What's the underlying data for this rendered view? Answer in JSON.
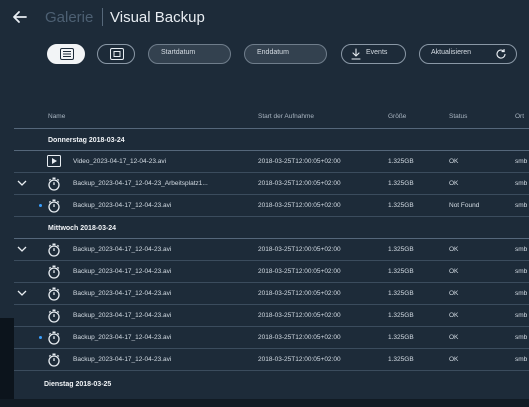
{
  "header": {
    "parent": "Galerie",
    "title": "Visual Backup"
  },
  "toolbar": {
    "start_date": "Startdatum",
    "end_date": "Enddatum",
    "events": "Events",
    "refresh": "Aktualisieren"
  },
  "columns": {
    "name": "Name",
    "start": "Start der Aufnahme",
    "size": "Größe",
    "status": "Status",
    "ort": "Ort"
  },
  "groups": [
    {
      "label": "Donnerstag 2018-03-24"
    },
    {
      "label": "Mittwoch 2018-03-24"
    },
    {
      "label": "Dienstag 2018-03-25"
    }
  ],
  "rows": [
    {
      "name": "Video_2023-04-17_12-04-23.avi",
      "start": "2018-03-25T12:00:05+02:00",
      "size": "1.325GB",
      "status": "OK",
      "ort": "smb"
    },
    {
      "name": "Backup_2023-04-17_12-04-23_Arbeitsplatz1...",
      "start": "2018-03-25T12:00:05+02:00",
      "size": "1.325GB",
      "status": "OK",
      "ort": "smb"
    },
    {
      "name": "Backup_2023-04-17_12-04-23.avi",
      "start": "2018-03-25T12:00:05+02:00",
      "size": "1.325GB",
      "status": "Not Found",
      "ort": "smb"
    },
    {
      "name": "Backup_2023-04-17_12-04-23.avi",
      "start": "2018-03-25T12:00:05+02:00",
      "size": "1.325GB",
      "status": "OK",
      "ort": "smb"
    },
    {
      "name": "Backup_2023-04-17_12-04-23.avi",
      "start": "2018-03-25T12:00:05+02:00",
      "size": "1.325GB",
      "status": "OK",
      "ort": "smb"
    },
    {
      "name": "Backup_2023-04-17_12-04-23.avi",
      "start": "2018-03-25T12:00:05+02:00",
      "size": "1.325GB",
      "status": "OK",
      "ort": "smb"
    },
    {
      "name": "Backup_2023-04-17_12-04-23.avi",
      "start": "2018-03-25T12:00:05+02:00",
      "size": "1.325GB",
      "status": "OK",
      "ort": "smb"
    },
    {
      "name": "Backup_2023-04-17_12-04-23.avi",
      "start": "2018-03-25T12:00:05+02:00",
      "size": "1.325GB",
      "status": "OK",
      "ort": "smb"
    },
    {
      "name": "Backup_2023-04-17_12-04-23.avi",
      "start": "2018-03-25T12:00:05+02:00",
      "size": "1.325GB",
      "status": "OK",
      "ort": "smb"
    }
  ],
  "colors": {
    "background": "#1d2b39",
    "accent_dot": "#3aa0ff"
  }
}
